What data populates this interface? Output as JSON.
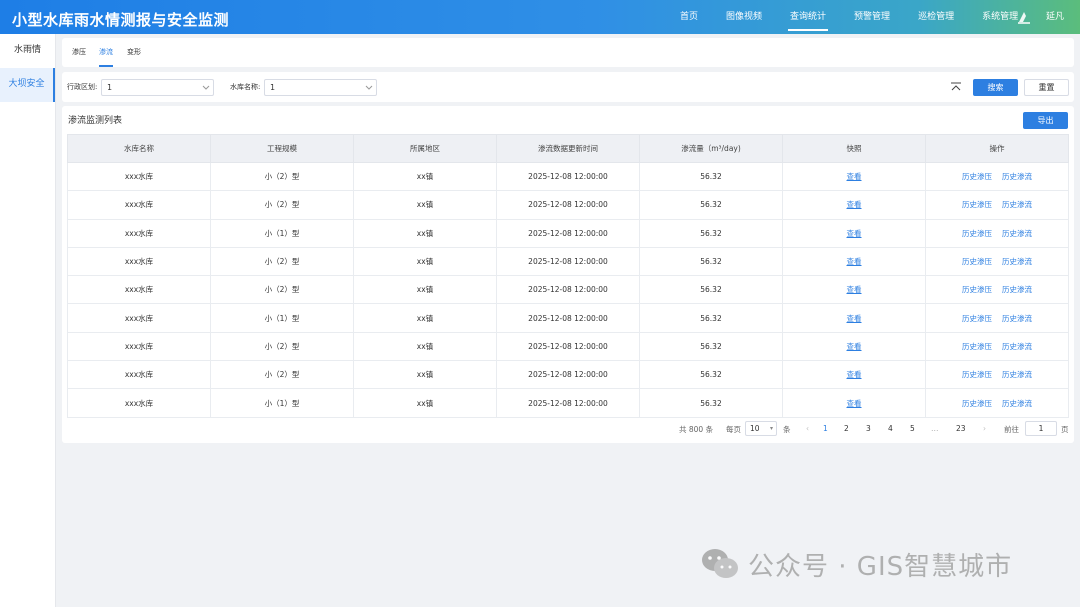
{
  "app": {
    "title": "小型水库雨水情测报与安全监测"
  },
  "topnav": [
    "首页",
    "图像视频",
    "查询统计",
    "预警管理",
    "巡检管理",
    "系统管理"
  ],
  "topnav_active": "查询统计",
  "user": {
    "name": "延凡",
    "icon": "user-avatar-icon"
  },
  "sidebar": {
    "items": [
      "水雨情",
      "大坝安全"
    ],
    "active": "大坝安全"
  },
  "tabs": {
    "items": [
      "渗压",
      "渗流",
      "变形"
    ],
    "active": "渗流"
  },
  "filters": {
    "region_label": "行政区划:",
    "region_value": "1",
    "reservoir_label": "水库名称:",
    "reservoir_value": "1"
  },
  "buttons": {
    "search": "搜索",
    "reset": "重置",
    "export": "导出"
  },
  "panel": {
    "title": "渗流监测列表"
  },
  "table": {
    "columns": [
      "水库名称",
      "工程规模",
      "所属地区",
      "渗流数据更新时间",
      "渗流量（m³/day)",
      "快照",
      "操作"
    ],
    "rows": [
      [
        "xxx水库",
        "小（2）型",
        "xx镇",
        "2025-12-08   12:00:00",
        "56.32"
      ],
      [
        "xxx水库",
        "小（2）型",
        "xx镇",
        "2025-12-08   12:00:00",
        "56.32"
      ],
      [
        "xxx水库",
        "小（1）型",
        "xx镇",
        "2025-12-08   12:00:00",
        "56.32"
      ],
      [
        "xxx水库",
        "小（2）型",
        "xx镇",
        "2025-12-08   12:00:00",
        "56.32"
      ],
      [
        "xxx水库",
        "小（2）型",
        "xx镇",
        "2025-12-08   12:00:00",
        "56.32"
      ],
      [
        "xxx水库",
        "小（1）型",
        "xx镇",
        "2025-12-08   12:00:00",
        "56.32"
      ],
      [
        "xxx水库",
        "小（2）型",
        "xx镇",
        "2025-12-08   12:00:00",
        "56.32"
      ],
      [
        "xxx水库",
        "小（2）型",
        "xx镇",
        "2025-12-08   12:00:00",
        "56.32"
      ],
      [
        "xxx水库",
        "小（1）型",
        "xx镇",
        "2025-12-08   12:00:00",
        "56.32"
      ]
    ],
    "snapshot_label": "查看",
    "action_labels": [
      "历史渗压",
      "历史渗流"
    ]
  },
  "pagination": {
    "total": "共 800 条",
    "per_page_prefix": "每页",
    "per_page_value": "10",
    "per_page_suffix": "条",
    "pages": [
      "1",
      "2",
      "3",
      "4",
      "5",
      "…",
      "23"
    ],
    "prev": "‹",
    "next": "›",
    "jump_prefix": "前往",
    "jump_value": "1",
    "jump_suffix": "页"
  },
  "watermark": {
    "text": "公众号 · GIS智慧城市",
    "icon": "wechat-icon"
  },
  "colors": {
    "primary": "#2d7fe1",
    "header_start": "#1e7ee6",
    "header_end": "#5bbd7c"
  }
}
